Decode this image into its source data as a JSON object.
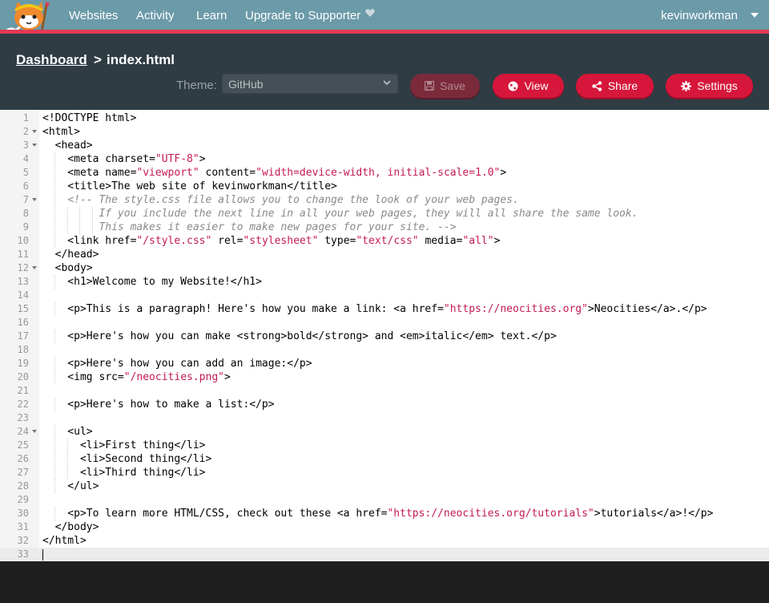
{
  "nav": {
    "links": [
      "Websites",
      "Activity",
      "Learn",
      "Upgrade to Supporter"
    ],
    "username": "kevinworkman"
  },
  "header": {
    "breadcrumb_root": "Dashboard",
    "breadcrumb_separator": ">",
    "filename": "index.html",
    "theme_label": "Theme:",
    "theme_value": "GitHub",
    "buttons": {
      "save": "Save",
      "view": "View",
      "share": "Share",
      "settings": "Settings"
    }
  },
  "colors": {
    "nav_bg": "#6b9aa8",
    "accent": "#d6163a",
    "header_bg": "#2f3c44",
    "string": "#c41a55",
    "comment": "#8a8a8a"
  },
  "editor": {
    "lines": [
      "<!DOCTYPE html>",
      "<html>",
      "  <head>",
      "    <meta charset=\"UTF-8\">",
      "    <meta name=\"viewport\" content=\"width=device-width, initial-scale=1.0\">",
      "    <title>The web site of kevinworkman</title>",
      "    <!-- The style.css file allows you to change the look of your web pages.",
      "         If you include the next line in all your web pages, they will all share the same look.",
      "         This makes it easier to make new pages for your site. -->",
      "    <link href=\"/style.css\" rel=\"stylesheet\" type=\"text/css\" media=\"all\">",
      "  </head>",
      "  <body>",
      "    <h1>Welcome to my Website!</h1>",
      "",
      "    <p>This is a paragraph! Here's how you make a link: <a href=\"https://neocities.org\">Neocities</a>.</p>",
      "",
      "    <p>Here's how you can make <strong>bold</strong> and <em>italic</em> text.</p>",
      "",
      "    <p>Here's how you can add an image:</p>",
      "    <img src=\"/neocities.png\">",
      "",
      "    <p>Here's how to make a list:</p>",
      "",
      "    <ul>",
      "      <li>First thing</li>",
      "      <li>Second thing</li>",
      "      <li>Third thing</li>",
      "    </ul>",
      "",
      "    <p>To learn more HTML/CSS, check out these <a href=\"https://neocities.org/tutorials\">tutorials</a>!</p>",
      "  </body>",
      "</html>",
      ""
    ],
    "fold_lines": [
      2,
      3,
      7,
      12,
      24
    ],
    "active_line": 33
  }
}
